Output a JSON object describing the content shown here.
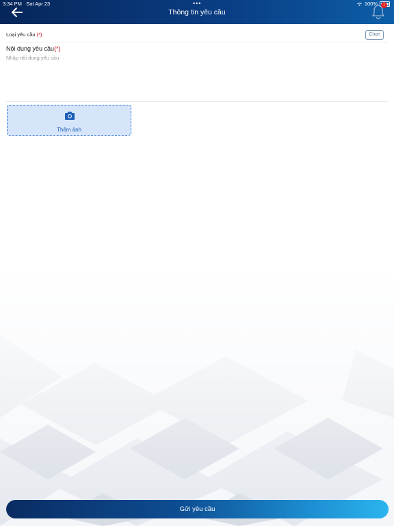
{
  "status_bar": {
    "time": "3:34 PM",
    "date": "Sat Apr 23",
    "dots": "•••",
    "battery": "100%"
  },
  "header": {
    "title": "Thông tin yêu cầu",
    "back_icon": "arrow-left-icon",
    "bell_icon": "bell-icon",
    "badge": "1"
  },
  "form": {
    "request_type_label": "Loại yêu cầu",
    "required_mark": "(*)",
    "choose_label": "Chọn",
    "content_label": "Nội dung yêu cầu",
    "content_value": "",
    "content_placeholder": "Nhập nội dung yêu cầu",
    "add_photo_label": "Thêm ảnh",
    "camera_icon": "camera-icon"
  },
  "submit": {
    "label": "Gửi yêu cầu"
  },
  "colors": {
    "header_dark": "#06265a",
    "accent": "#1d5fb8",
    "required": "#d0021b",
    "submit_end": "#2cb5ee"
  }
}
